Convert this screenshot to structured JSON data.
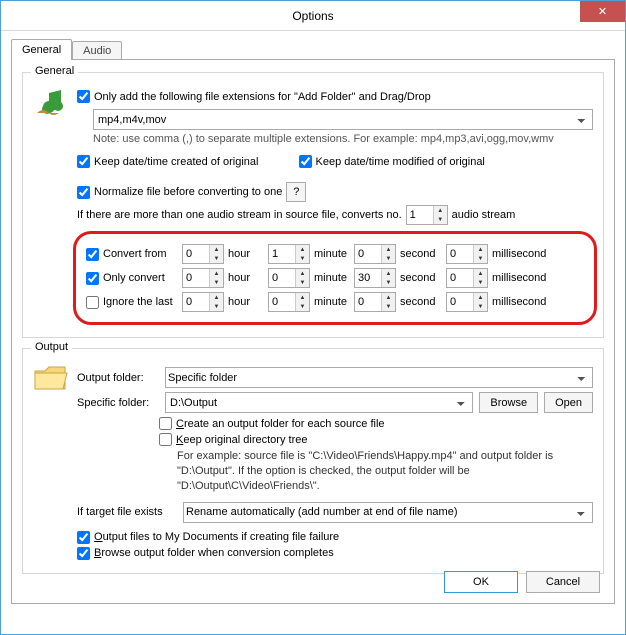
{
  "window": {
    "title": "Options"
  },
  "tabs": {
    "general": "General",
    "audio": "Audio"
  },
  "general": {
    "legend": "General",
    "only_add_ext_label": "Only add the following file extensions for \"Add Folder\" and Drag/Drop",
    "ext_value": "mp4,m4v,mov",
    "ext_note": "Note: use comma (,) to separate multiple extensions. For example: mp4,mp3,avi,ogg,mov,wmv",
    "keep_created": "Keep date/time created of original",
    "keep_modified": "Keep date/time modified of original",
    "normalize": "Normalize file before converting to one",
    "multi_audio_pre": "If there are more than one audio stream in source file, converts no.",
    "multi_audio_value": "1",
    "multi_audio_post": "audio stream",
    "convert_from": "Convert from",
    "only_convert": "Only convert",
    "ignore_last": "Ignore the last",
    "unit_hour": "hour",
    "unit_minute": "minute",
    "unit_second": "second",
    "unit_ms": "millisecond",
    "times": {
      "from": {
        "h": "0",
        "m": "1",
        "s": "0",
        "ms": "0"
      },
      "only": {
        "h": "0",
        "m": "0",
        "s": "30",
        "ms": "0"
      },
      "ignore": {
        "h": "0",
        "m": "0",
        "s": "0",
        "ms": "0"
      }
    }
  },
  "output": {
    "legend": "Output",
    "folder_label": "Output folder:",
    "folder_value": "Specific folder",
    "specific_label": "Specific folder:",
    "specific_value": "D:\\Output",
    "browse": "Browse",
    "open": "Open",
    "create_folder": "Create an output folder for each source file",
    "keep_tree": "Keep original directory tree",
    "example1": "For example: source file is \"C:\\Video\\Friends\\Happy.mp4\" and output folder is \"D:\\Output\". If the option is checked, the output folder will be \"D:\\Output\\C\\Video\\Friends\\\".",
    "exists_label": "If target file exists",
    "exists_value": "Rename automatically (add number at end of file name)",
    "to_mydocs": "Output files to My Documents if creating file failure",
    "browse_after": "Browse output folder when conversion completes"
  },
  "footer": {
    "ok": "OK",
    "cancel": "Cancel"
  }
}
